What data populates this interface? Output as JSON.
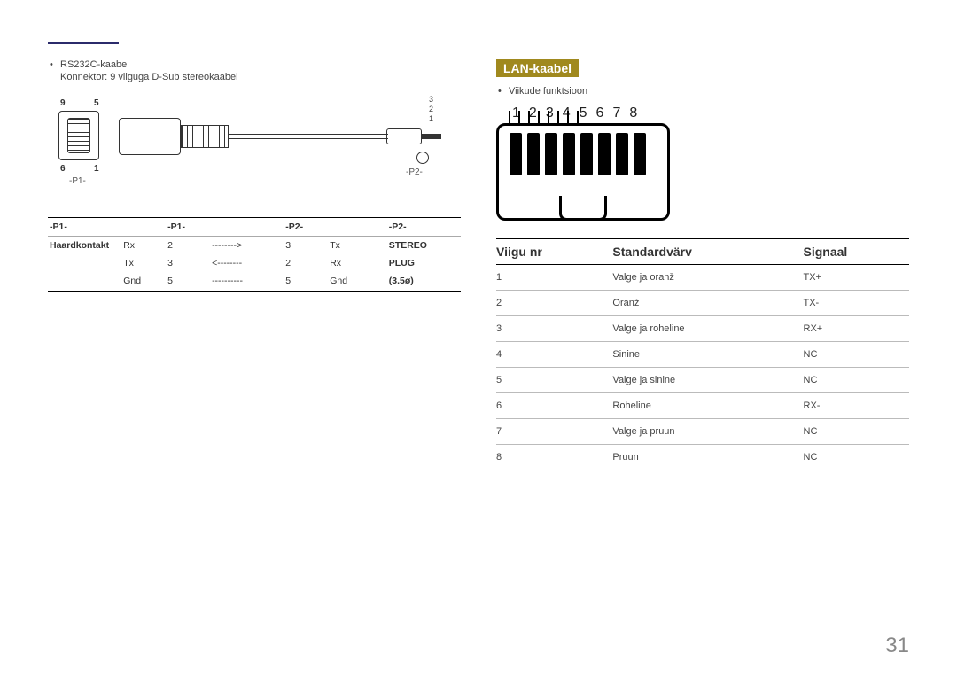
{
  "page_number": "31",
  "left": {
    "bullet": "RS232C-kaabel",
    "sub": "Konnektor: 9 viiguga D-Sub stereokaabel",
    "diagram": {
      "p1_label": "-P1-",
      "p2_label": "-P2-",
      "corner_9": "9",
      "corner_5": "5",
      "corner_6": "6",
      "corner_1": "1",
      "jack_3": "3",
      "jack_2": "2",
      "jack_1": "1"
    },
    "pin_table": {
      "headers": [
        "-P1-",
        "",
        "-P1-",
        "",
        "-P2-",
        "",
        "-P2-"
      ],
      "row_label": "Haardkontakt",
      "right_label_1": "STEREO",
      "right_label_2": "PLUG",
      "right_label_3": "(3.5ø)",
      "rows": [
        {
          "c1": "Rx",
          "c2": "2",
          "c3": "-------->",
          "c4": "3",
          "c5": "Tx"
        },
        {
          "c1": "Tx",
          "c2": "3",
          "c3": "<--------",
          "c4": "2",
          "c5": "Rx"
        },
        {
          "c1": "Gnd",
          "c2": "5",
          "c3": "----------",
          "c4": "5",
          "c5": "Gnd"
        }
      ]
    }
  },
  "right": {
    "section_title": "LAN-kaabel",
    "bullet": "Viikude funktsioon",
    "pin_numbers": [
      "1",
      "2",
      "3",
      "4",
      "5",
      "6",
      "7",
      "8"
    ],
    "table": {
      "headers": {
        "pin": "Viigu nr",
        "color": "Standardvärv",
        "signal": "Signaal"
      },
      "rows": [
        {
          "pin": "1",
          "color": "Valge ja oranž",
          "signal": "TX+"
        },
        {
          "pin": "2",
          "color": "Oranž",
          "signal": "TX-"
        },
        {
          "pin": "3",
          "color": "Valge ja roheline",
          "signal": "RX+"
        },
        {
          "pin": "4",
          "color": "Sinine",
          "signal": "NC"
        },
        {
          "pin": "5",
          "color": "Valge ja sinine",
          "signal": "NC"
        },
        {
          "pin": "6",
          "color": "Roheline",
          "signal": "RX-"
        },
        {
          "pin": "7",
          "color": "Valge ja pruun",
          "signal": "NC"
        },
        {
          "pin": "8",
          "color": "Pruun",
          "signal": "NC"
        }
      ]
    }
  }
}
